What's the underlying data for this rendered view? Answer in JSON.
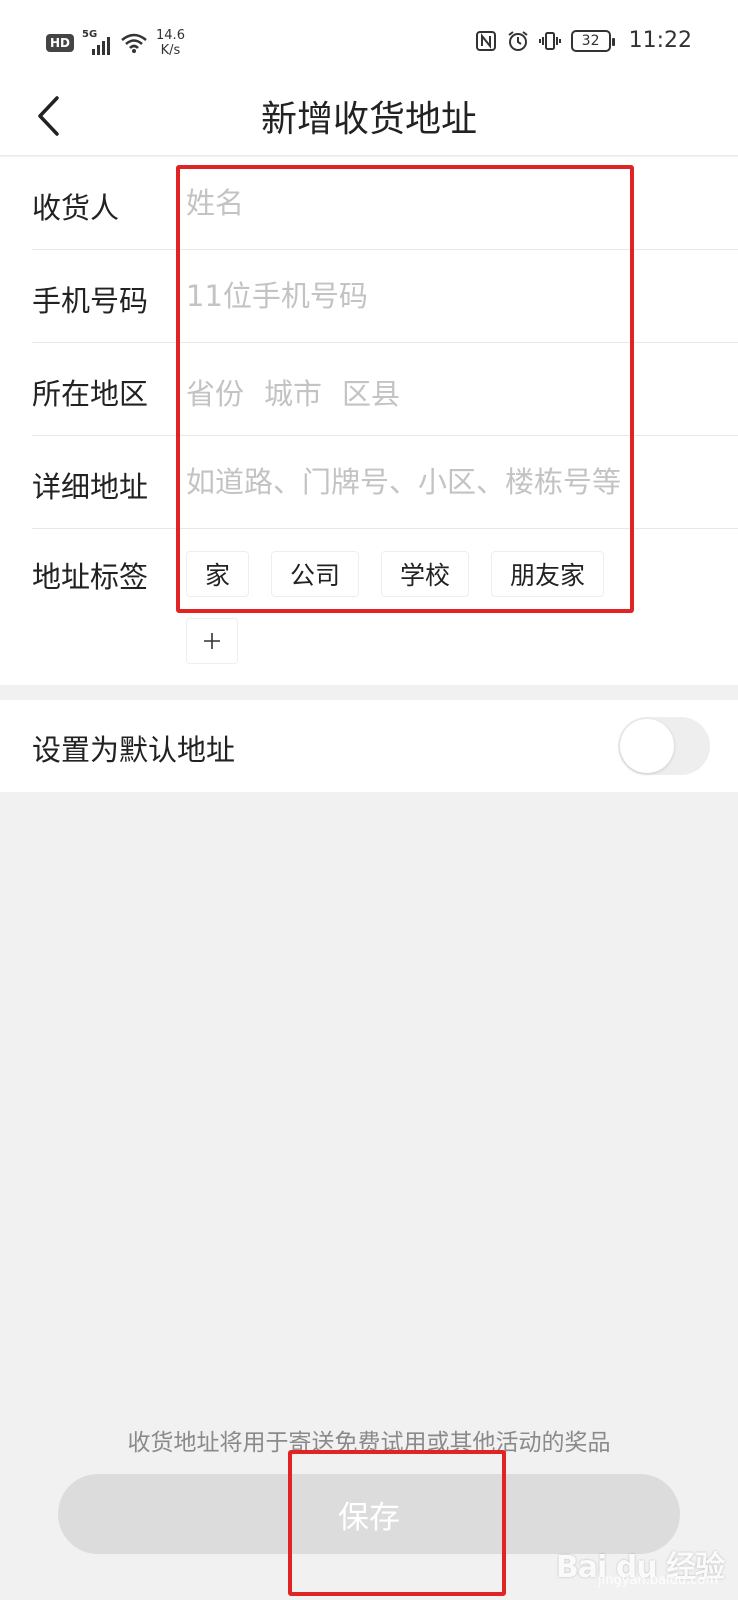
{
  "status_bar": {
    "hd": "HD",
    "network": "5G",
    "speed_value": "14.6",
    "speed_unit": "K/s",
    "battery": "32",
    "time": "11:22"
  },
  "header": {
    "title": "新增收货地址"
  },
  "form": {
    "name": {
      "label": "收货人",
      "placeholder": "姓名"
    },
    "phone": {
      "label": "手机号码",
      "placeholder": "11位手机号码"
    },
    "region": {
      "label": "所在地区",
      "province": "省份",
      "city": "城市",
      "district": "区县"
    },
    "address": {
      "label": "详细地址",
      "placeholder": "如道路、门牌号、小区、楼栋号等"
    },
    "tags": {
      "label": "地址标签",
      "items": [
        "家",
        "公司",
        "学校",
        "朋友家"
      ],
      "add_icon": "plus-icon"
    }
  },
  "default_address": {
    "label": "设置为默认地址",
    "enabled": false
  },
  "footer": {
    "notice": "收货地址将用于寄送免费试用或其他活动的奖品",
    "save_label": "保存"
  },
  "watermark": {
    "text": "Bai du 经验",
    "sub": "jingyan.baidu.com"
  },
  "colors": {
    "annotation_red": "#e02424",
    "placeholder": "#c3c3c3",
    "save_button_bg": "#dcdcdc",
    "page_bg": "#f1f1f1"
  }
}
